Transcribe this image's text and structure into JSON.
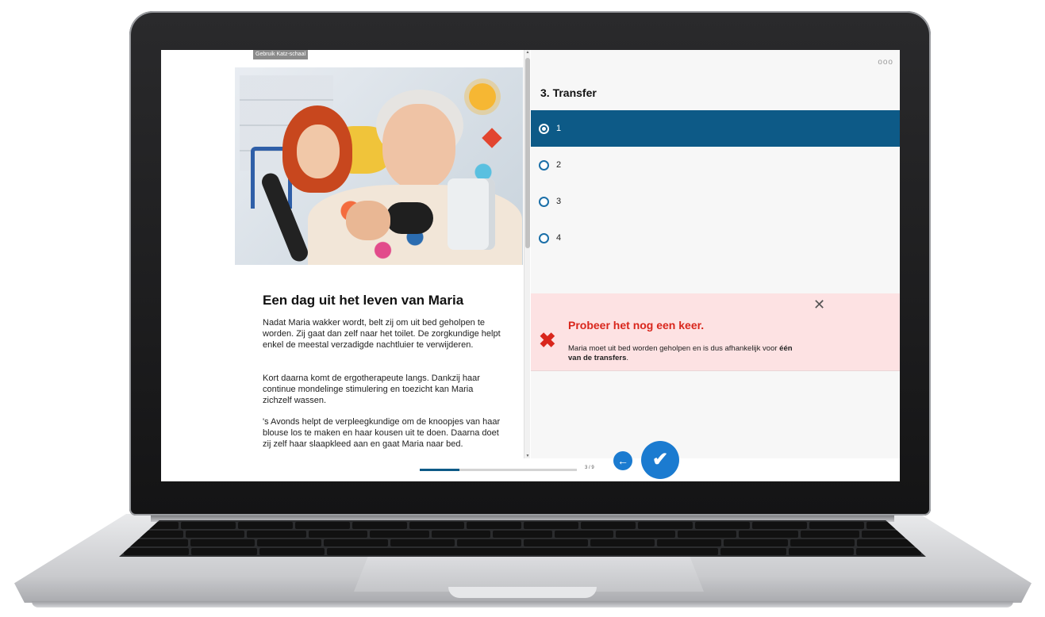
{
  "left": {
    "tag": "Gebruik Katz-schaal",
    "title": "Een dag uit het leven van Maria",
    "paragraphs": [
      "Nadat Maria wakker wordt, belt zij om uit bed geholpen te worden. Zij gaat dan zelf naar het toilet. De zorgkundige helpt enkel de meestal verzadigde nachtluier te verwijderen.",
      "Kort daarna komt de ergotherapeute langs. Dankzij haar continue mondelinge stimulering en toezicht kan Maria zichzelf wassen.",
      "'s Avonds helpt de verpleegkundige om de knoopjes van haar blouse los te maken en haar kousen uit te doen. Daarna doet zij zelf haar slaapkleed aan en gaat Maria naar bed."
    ]
  },
  "right": {
    "menu": "ooo",
    "question": "3. Transfer",
    "options": [
      "1",
      "2",
      "3",
      "4"
    ],
    "selected_index": 0,
    "feedback": {
      "close": "✕",
      "icon": "✖",
      "title": "Probeer het nog een keer.",
      "text_before": "Maria moet uit bed worden geholpen en is dus afhankelijk voor ",
      "text_bold": "één van de transfers",
      "text_after": "."
    }
  },
  "footer": {
    "progress_label": "3 / 9",
    "progress_fraction": 0.25,
    "back_icon": "arrow-left-icon",
    "check_icon": "checkmark-icon"
  },
  "colors": {
    "accent": "#0d5a87",
    "button": "#1b7bd0",
    "error": "#d9261c",
    "feedback_bg": "#fde2e3"
  }
}
